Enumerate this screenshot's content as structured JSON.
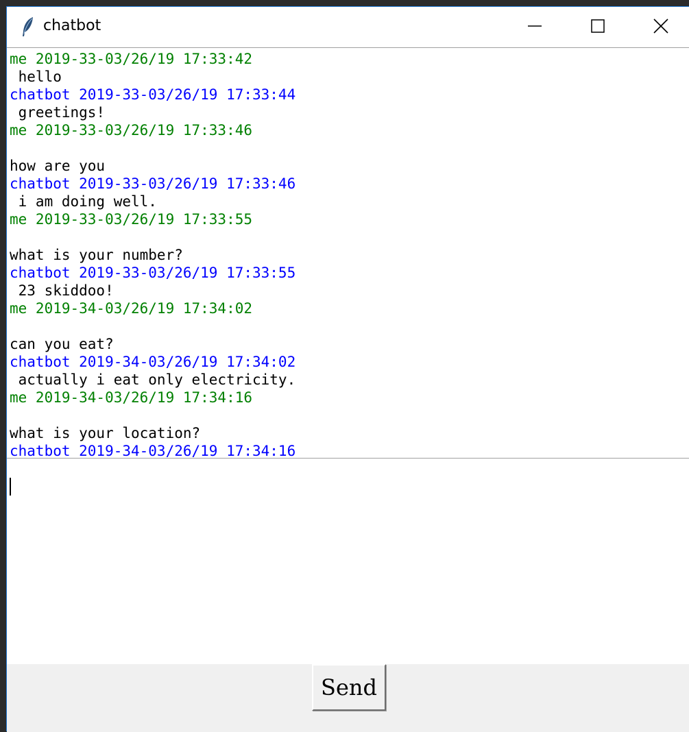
{
  "window": {
    "title": "chatbot",
    "icon": "feather-icon",
    "controls": [
      "minimize-icon",
      "maximize-icon",
      "close-icon"
    ]
  },
  "chat": {
    "lines": [
      {
        "type": "me",
        "text": "me 2019-33-03/26/19 17:33:42"
      },
      {
        "type": "msg",
        "text": " hello"
      },
      {
        "type": "bot",
        "text": "chatbot 2019-33-03/26/19 17:33:44"
      },
      {
        "type": "msg",
        "text": " greetings!"
      },
      {
        "type": "me",
        "text": "me 2019-33-03/26/19 17:33:46"
      },
      {
        "type": "msg",
        "text": ""
      },
      {
        "type": "msg",
        "text": "how are you"
      },
      {
        "type": "bot",
        "text": "chatbot 2019-33-03/26/19 17:33:46"
      },
      {
        "type": "msg",
        "text": " i am doing well."
      },
      {
        "type": "me",
        "text": "me 2019-33-03/26/19 17:33:55"
      },
      {
        "type": "msg",
        "text": ""
      },
      {
        "type": "msg",
        "text": "what is your number?"
      },
      {
        "type": "bot",
        "text": "chatbot 2019-33-03/26/19 17:33:55"
      },
      {
        "type": "msg",
        "text": " 23 skiddoo!"
      },
      {
        "type": "me",
        "text": "me 2019-34-03/26/19 17:34:02"
      },
      {
        "type": "msg",
        "text": ""
      },
      {
        "type": "msg",
        "text": "can you eat?"
      },
      {
        "type": "bot",
        "text": "chatbot 2019-34-03/26/19 17:34:02"
      },
      {
        "type": "msg",
        "text": " actually i eat only electricity."
      },
      {
        "type": "me",
        "text": "me 2019-34-03/26/19 17:34:16"
      },
      {
        "type": "msg",
        "text": ""
      },
      {
        "type": "msg",
        "text": "what is your location?"
      },
      {
        "type": "bot",
        "text": "chatbot 2019-34-03/26/19 17:34:16"
      }
    ]
  },
  "input": {
    "value": ""
  },
  "send_button": {
    "label": "Send"
  },
  "colors": {
    "me": "#008000",
    "bot": "#0000ff",
    "message": "#000000",
    "window_border": "#1e77d3",
    "button_bar": "#f0f0f0"
  }
}
